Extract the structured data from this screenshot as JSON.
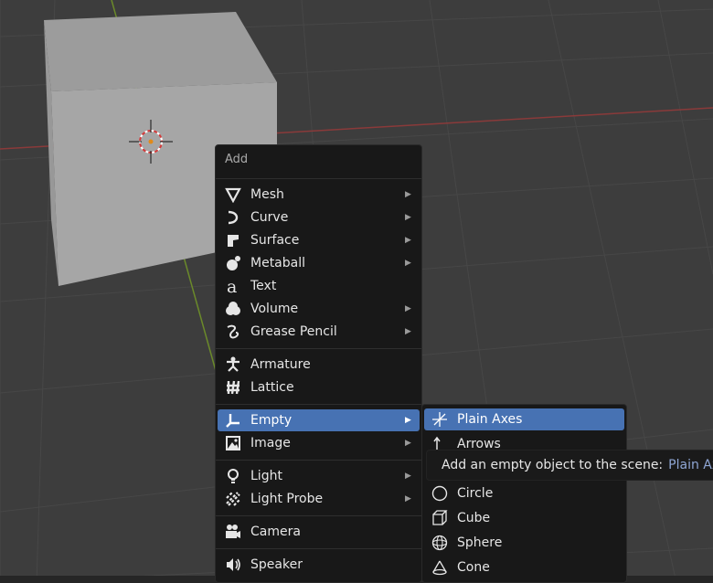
{
  "add_menu": {
    "title": "Add",
    "items": [
      {
        "label": "Mesh",
        "icon": "mesh-icon",
        "submenu": true
      },
      {
        "label": "Curve",
        "icon": "curve-icon",
        "submenu": true
      },
      {
        "label": "Surface",
        "icon": "surface-icon",
        "submenu": true
      },
      {
        "label": "Metaball",
        "icon": "metaball-icon",
        "submenu": true
      },
      {
        "label": "Text",
        "icon": "text-icon",
        "submenu": false
      },
      {
        "label": "Volume",
        "icon": "volume-icon",
        "submenu": true
      },
      {
        "label": "Grease Pencil",
        "icon": "grease-pencil-icon",
        "submenu": true
      },
      {
        "label": "Armature",
        "icon": "armature-icon",
        "submenu": false
      },
      {
        "label": "Lattice",
        "icon": "lattice-icon",
        "submenu": false
      },
      {
        "label": "Empty",
        "icon": "empty-icon",
        "submenu": true,
        "active": true
      },
      {
        "label": "Image",
        "icon": "image-icon",
        "submenu": true
      },
      {
        "label": "Light",
        "icon": "light-icon",
        "submenu": true
      },
      {
        "label": "Light Probe",
        "icon": "light-probe-icon",
        "submenu": true
      },
      {
        "label": "Camera",
        "icon": "camera-icon",
        "submenu": false
      },
      {
        "label": "Speaker",
        "icon": "speaker-icon",
        "submenu": false
      }
    ]
  },
  "empty_submenu": {
    "items": [
      {
        "label": "Plain Axes",
        "icon": "plain-axes-icon",
        "active": true
      },
      {
        "label": "Arrows",
        "icon": "arrows-icon"
      },
      {
        "label": "Circle",
        "icon": "circle-icon"
      },
      {
        "label": "Cube",
        "icon": "cube-icon"
      },
      {
        "label": "Sphere",
        "icon": "sphere-icon"
      },
      {
        "label": "Cone",
        "icon": "cone-icon"
      }
    ]
  },
  "tooltip": {
    "text": "Add an empty object to the scene:",
    "value": "Plain Axes"
  },
  "colors": {
    "background": "#3d3d3d",
    "grid": "#464646",
    "x_axis": "#8a3a3a",
    "y_axis": "#6b8a2a",
    "cube_front": "#a8a8a8",
    "cube_top": "#9c9c9c",
    "menu_bg": "#181818",
    "highlight": "#4772b3",
    "tooltip_value": "#8fa6d4"
  }
}
